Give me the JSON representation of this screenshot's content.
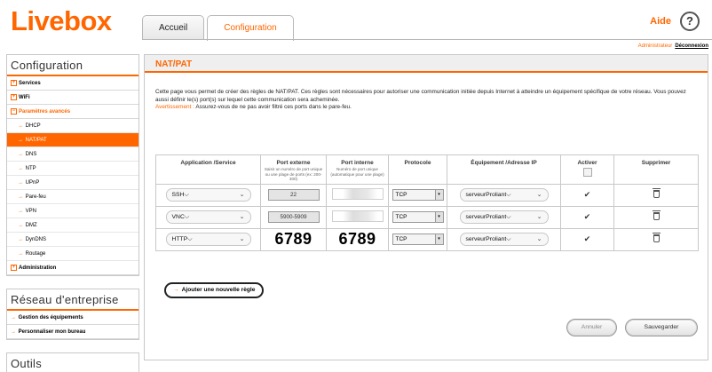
{
  "header": {
    "logo": "Livebox",
    "tabs": [
      {
        "label": "Accueil"
      },
      {
        "label": "Configuration"
      }
    ],
    "help_label": "Aide",
    "help_icon_glyph": "?",
    "user": "Administrateur",
    "logout": "Déconnexion"
  },
  "sidebar": {
    "config_title": "Configuration",
    "items": [
      {
        "label": "Services"
      },
      {
        "label": "WiFi"
      },
      {
        "label": "Paramètres avancés"
      }
    ],
    "subitems": [
      {
        "label": "DHCP"
      },
      {
        "label": "NAT/PAT"
      },
      {
        "label": "DNS"
      },
      {
        "label": "NTP"
      },
      {
        "label": "UPnP"
      },
      {
        "label": "Pare-feu"
      },
      {
        "label": "VPN"
      },
      {
        "label": "DMZ"
      },
      {
        "label": "DynDNS"
      },
      {
        "label": "Routage"
      }
    ],
    "admin_label": "Administration",
    "network_title": "Réseau d'entreprise",
    "network_items": [
      {
        "label": "Gestion des équipements"
      },
      {
        "label": "Personnaliser mon bureau"
      }
    ],
    "tools_title": "Outils"
  },
  "main": {
    "title": "NAT/PAT",
    "intro": "Cette page vous permet de créer des règles de NAT/PAT. Ces règles sont nécessaires pour autoriser une communication initiée depuis Internet à atteindre un équipement spécifique de votre réseau. Vous pouvez aussi définir le(s) port(s) sur lequel cette communication sera acheminée.",
    "warning_label": "Avertissement :",
    "warning_text": "Assurez-vous de ne pas avoir filtré ces ports dans le pare-feu.",
    "table": {
      "headers": {
        "application": "Application /Service",
        "port_ext": "Port externe",
        "port_ext_hint": "Saisir un numéro de port unique ou une plage de ports (ex: 200-300)",
        "port_int": "Port interne",
        "port_int_hint": "Numéro de port unique (automatique pour une plage)",
        "protocol": "Protocole",
        "device": "Équipement /Adresse IP",
        "activate": "Activer",
        "delete": "Supprimer"
      },
      "rows": [
        {
          "app": "SSH",
          "port_ext": "22",
          "port_int": "",
          "protocol": "TCP",
          "device": "serveurProliant",
          "active": "✔"
        },
        {
          "app": "VNC",
          "port_ext": "5900-5909",
          "port_int": "",
          "protocol": "TCP",
          "device": "serveurProliant",
          "active": "✔"
        },
        {
          "app": "HTTP",
          "port_ext": "6789",
          "port_int": "6789",
          "protocol": "TCP",
          "device": "serveurProliant",
          "active": "✔"
        }
      ]
    },
    "add_rule": "Ajouter une nouvelle règle",
    "cancel": "Annuler",
    "save": "Sauvegarder"
  }
}
